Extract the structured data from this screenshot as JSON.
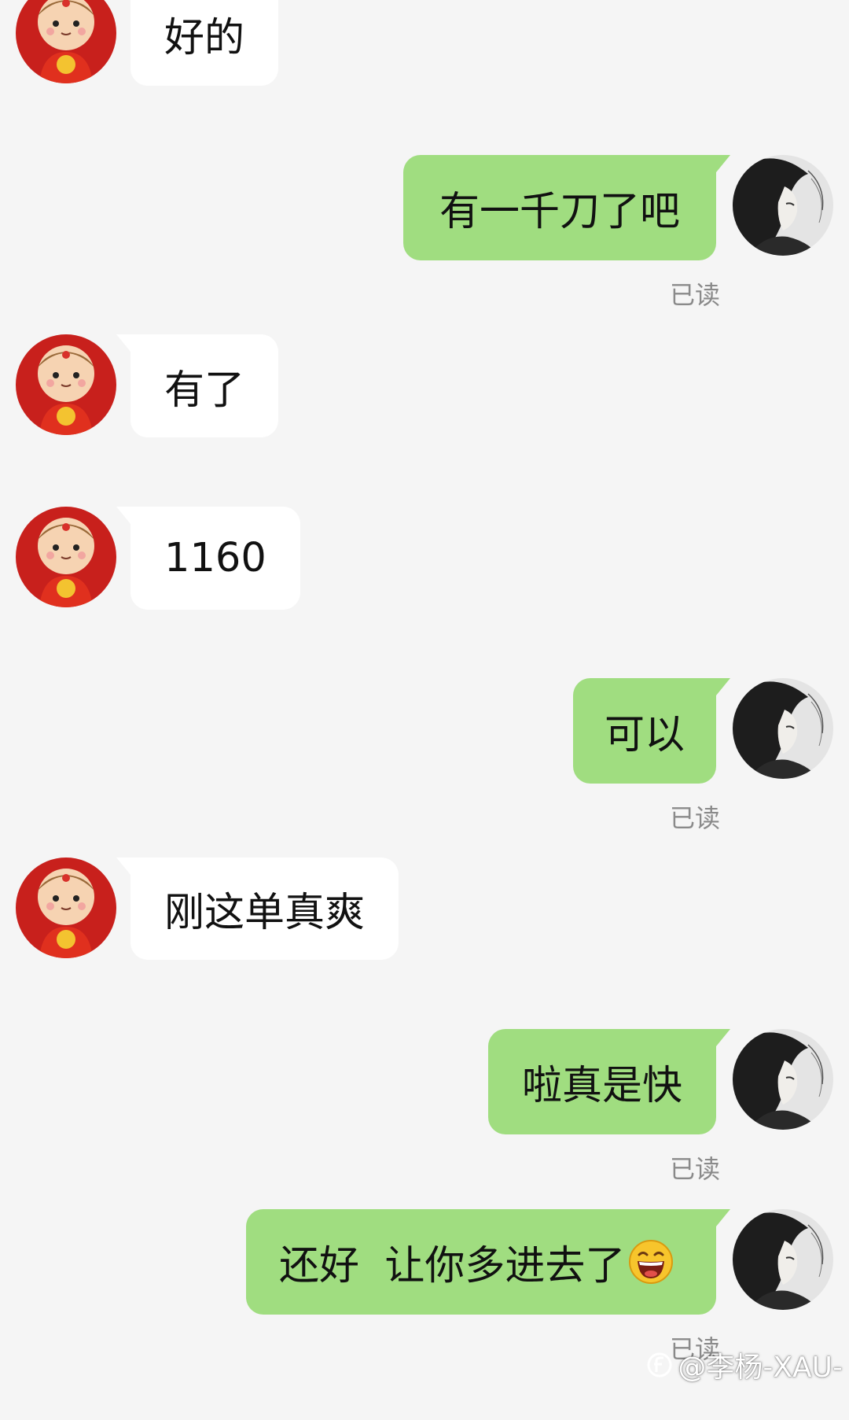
{
  "colors": {
    "background": "#f5f5f5",
    "incoming_bubble": "#ffffff",
    "outgoing_bubble": "#a0dd80",
    "read_receipt": "#8a8a8a"
  },
  "messages": [
    {
      "side": "incoming",
      "text": "好的"
    },
    {
      "side": "outgoing",
      "text": "有一千刀了吧",
      "status": "已读"
    },
    {
      "side": "incoming",
      "text": "有了"
    },
    {
      "side": "incoming",
      "text": "1160"
    },
    {
      "side": "outgoing",
      "text": "可以",
      "status": "已读"
    },
    {
      "side": "incoming",
      "text": "刚这单真爽"
    },
    {
      "side": "outgoing",
      "text": "啦真是快",
      "status": "已读"
    },
    {
      "side": "outgoing",
      "text": "还好  让你多进去了",
      "emoji": "laughing-face-icon",
      "status": "已读"
    }
  ],
  "watermark": {
    "icon": "platform-logo-icon",
    "text": "@李杨-XAU-"
  }
}
